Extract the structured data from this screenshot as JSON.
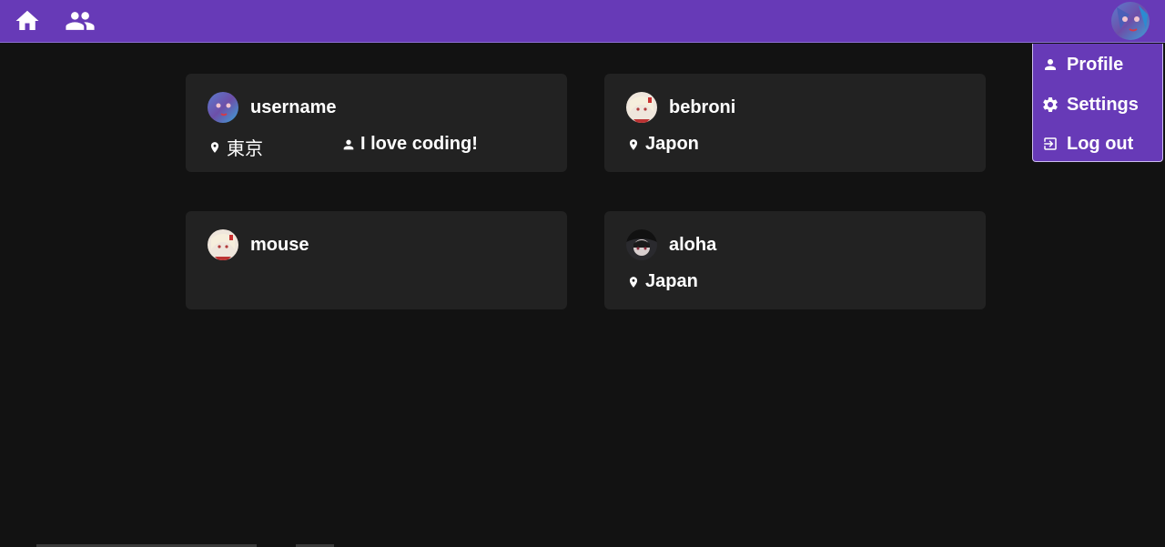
{
  "nav": {
    "home_icon": "home-icon",
    "users_icon": "users-icon",
    "avatar_icon": "avatar"
  },
  "menu": {
    "items": [
      {
        "label": "Profile",
        "icon": "person-icon"
      },
      {
        "label": "Settings",
        "icon": "gear-icon"
      },
      {
        "label": "Log out",
        "icon": "logout-icon"
      }
    ]
  },
  "users": [
    {
      "name": "username",
      "location": "東京",
      "bio": "I love coding!"
    },
    {
      "name": "bebroni",
      "location": "Japon",
      "bio": ""
    },
    {
      "name": "mouse",
      "location": "",
      "bio": ""
    },
    {
      "name": "aloha",
      "location": "Japan",
      "bio": ""
    }
  ],
  "colors": {
    "accent": "#673ab7",
    "background": "#121212",
    "card": "#222222",
    "text": "#ffffff"
  }
}
